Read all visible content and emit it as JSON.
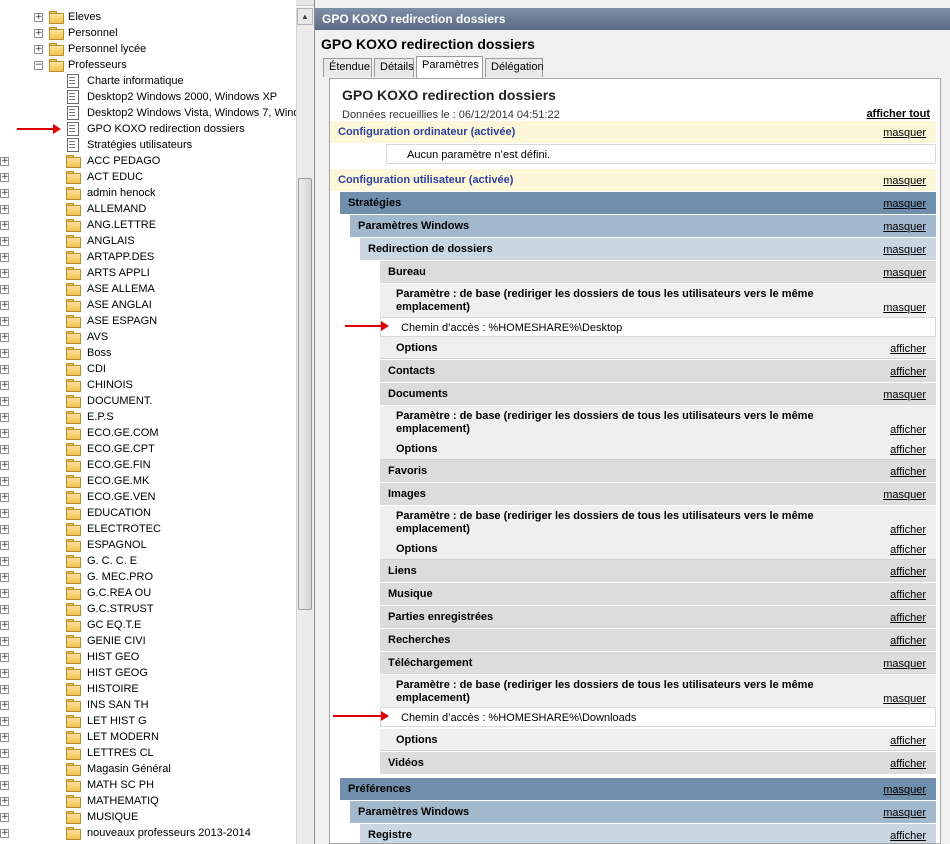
{
  "tree": {
    "items": [
      {
        "label": "Eleves",
        "icon": "folder-icon",
        "expander": "+"
      },
      {
        "label": "Personnel",
        "icon": "folder-icon",
        "expander": "+"
      },
      {
        "label": "Personnel lycée",
        "icon": "folder-icon",
        "expander": "+"
      },
      {
        "label": "Professeurs",
        "icon": "folder-icon",
        "expander": "−"
      },
      {
        "label": "Charte informatique",
        "icon": "gpo-link-icon",
        "expander": ""
      },
      {
        "label": "Desktop2 Windows 2000, Windows XP",
        "icon": "gpo-link-icon",
        "expander": ""
      },
      {
        "label": "Desktop2 Windows Vista, Windows 7, Wind",
        "icon": "gpo-link-icon",
        "expander": ""
      },
      {
        "label": "GPO KOXO redirection dossiers",
        "icon": "gpo-link-icon",
        "expander": ""
      },
      {
        "label": "Stratégies utilisateurs",
        "icon": "gpo-link-icon",
        "expander": ""
      },
      {
        "label": "ACC PEDAGO",
        "icon": "folder-icon",
        "expander": "+"
      },
      {
        "label": "ACT EDUC",
        "icon": "folder-icon",
        "expander": "+"
      },
      {
        "label": "admin henock",
        "icon": "folder-icon",
        "expander": "+"
      },
      {
        "label": "ALLEMAND",
        "icon": "folder-icon",
        "expander": "+"
      },
      {
        "label": "ANG.LETTRE",
        "icon": "folder-icon",
        "expander": "+"
      },
      {
        "label": "ANGLAIS",
        "icon": "folder-icon",
        "expander": "+"
      },
      {
        "label": "ARTAPP.DES",
        "icon": "folder-icon",
        "expander": "+"
      },
      {
        "label": "ARTS APPLI",
        "icon": "folder-icon",
        "expander": "+"
      },
      {
        "label": "ASE ALLEMA",
        "icon": "folder-icon",
        "expander": "+"
      },
      {
        "label": "ASE ANGLAI",
        "icon": "folder-icon",
        "expander": "+"
      },
      {
        "label": "ASE ESPAGN",
        "icon": "folder-icon",
        "expander": "+"
      },
      {
        "label": "AVS",
        "icon": "folder-icon",
        "expander": "+"
      },
      {
        "label": "Boss",
        "icon": "folder-icon",
        "expander": "+"
      },
      {
        "label": "CDI",
        "icon": "folder-icon",
        "expander": "+"
      },
      {
        "label": "CHINOIS",
        "icon": "folder-icon",
        "expander": "+"
      },
      {
        "label": "DOCUMENT.",
        "icon": "folder-icon",
        "expander": "+"
      },
      {
        "label": "E.P.S",
        "icon": "folder-icon",
        "expander": "+"
      },
      {
        "label": "ECO.GE.COM",
        "icon": "folder-icon",
        "expander": "+"
      },
      {
        "label": "ECO.GE.CPT",
        "icon": "folder-icon",
        "expander": "+"
      },
      {
        "label": "ECO.GE.FIN",
        "icon": "folder-icon",
        "expander": "+"
      },
      {
        "label": "ECO.GE.MK",
        "icon": "folder-icon",
        "expander": "+"
      },
      {
        "label": "ECO.GE.VEN",
        "icon": "folder-icon",
        "expander": "+"
      },
      {
        "label": "EDUCATION",
        "icon": "folder-icon",
        "expander": "+"
      },
      {
        "label": "ELECTROTEC",
        "icon": "folder-icon",
        "expander": "+"
      },
      {
        "label": "ESPAGNOL",
        "icon": "folder-icon",
        "expander": "+"
      },
      {
        "label": "G. C. C. E",
        "icon": "folder-icon",
        "expander": "+"
      },
      {
        "label": "G. MEC.PRO",
        "icon": "folder-icon",
        "expander": "+"
      },
      {
        "label": "G.C.REA OU",
        "icon": "folder-icon",
        "expander": "+"
      },
      {
        "label": "G.C.STRUST",
        "icon": "folder-icon",
        "expander": "+"
      },
      {
        "label": "GC EQ.T.E",
        "icon": "folder-icon",
        "expander": "+"
      },
      {
        "label": "GENIE CIVI",
        "icon": "folder-icon",
        "expander": "+"
      },
      {
        "label": "HIST GEO",
        "icon": "folder-icon",
        "expander": "+"
      },
      {
        "label": "HIST GEOG",
        "icon": "folder-icon",
        "expander": "+"
      },
      {
        "label": "HISTOIRE",
        "icon": "folder-icon",
        "expander": "+"
      },
      {
        "label": "INS SAN TH",
        "icon": "folder-icon",
        "expander": "+"
      },
      {
        "label": "LET HIST G",
        "icon": "folder-icon",
        "expander": "+"
      },
      {
        "label": "LET MODERN",
        "icon": "folder-icon",
        "expander": "+"
      },
      {
        "label": "LETTRES CL",
        "icon": "folder-icon",
        "expander": "+"
      },
      {
        "label": "Magasin Général",
        "icon": "folder-icon",
        "expander": "+"
      },
      {
        "label": "MATH SC PH",
        "icon": "folder-icon",
        "expander": "+"
      },
      {
        "label": "MATHEMATIQ",
        "icon": "folder-icon",
        "expander": "+"
      },
      {
        "label": "MUSIQUE",
        "icon": "folder-icon",
        "expander": "+"
      },
      {
        "label": "nouveaux professeurs 2013-2014",
        "icon": "folder-icon",
        "expander": "+"
      }
    ]
  },
  "window": {
    "title": "GPO KOXO redirection dossiers"
  },
  "pane": {
    "heading": "GPO KOXO redirection dossiers",
    "tabs": [
      "Étendue",
      "Détails",
      "Paramètres",
      "Délégation"
    ],
    "active_tab": "Paramètres"
  },
  "report": {
    "title": "GPO KOXO redirection dossiers",
    "date": "Données recueillies le : 06/12/2014 04:51:22",
    "show_all": "afficher tout",
    "rows": [
      {
        "type": "cfg",
        "title": "Configuration ordinateur (activée)",
        "link": "masquer"
      },
      {
        "type": "text",
        "indent": 1,
        "text": "Aucun paramètre n’est défini."
      },
      {
        "type": "cfg",
        "title": "Configuration utilisateur (activée)",
        "link": "masquer"
      },
      {
        "type": "l1",
        "title": "Stratégies",
        "link": "masquer"
      },
      {
        "type": "l2",
        "title": "Paramètres Windows",
        "link": "masquer"
      },
      {
        "type": "l3",
        "title": "Redirection de dossiers",
        "link": "masquer"
      },
      {
        "type": "l4",
        "title": "Bureau",
        "link": "masquer"
      },
      {
        "type": "l4t",
        "title": "Paramètre : de base (rediriger les dossiers de tous les utilisateurs vers le même emplacement)",
        "link": "masquer"
      },
      {
        "type": "text",
        "indent": 2,
        "text": "Chemin d’accès : %HOMESHARE%\\Desktop",
        "arrow": true
      },
      {
        "type": "l4",
        "title": "Options",
        "link": "afficher",
        "sub": true
      },
      {
        "type": "l4",
        "title": "Contacts",
        "link": "afficher"
      },
      {
        "type": "l4",
        "title": "Documents",
        "link": "masquer"
      },
      {
        "type": "l4t",
        "title": "Paramètre : de base (rediriger les dossiers de tous les utilisateurs vers le même emplacement)",
        "link": "afficher"
      },
      {
        "type": "l4",
        "title": "Options",
        "link": "afficher",
        "sub": true
      },
      {
        "type": "l4",
        "title": "Favoris",
        "link": "afficher"
      },
      {
        "type": "l4",
        "title": "Images",
        "link": "masquer"
      },
      {
        "type": "l4t",
        "title": "Paramètre : de base (rediriger les dossiers de tous les utilisateurs vers le même emplacement)",
        "link": "afficher"
      },
      {
        "type": "l4",
        "title": "Options",
        "link": "afficher",
        "sub": true
      },
      {
        "type": "l4",
        "title": "Liens",
        "link": "afficher"
      },
      {
        "type": "l4",
        "title": "Musique",
        "link": "afficher"
      },
      {
        "type": "l4",
        "title": "Parties enregistrées",
        "link": "afficher"
      },
      {
        "type": "l4",
        "title": "Recherches",
        "link": "afficher"
      },
      {
        "type": "l4",
        "title": "Téléchargement",
        "link": "masquer"
      },
      {
        "type": "l4t",
        "title": "Paramètre : de base (rediriger les dossiers de tous les utilisateurs vers le même emplacement)",
        "link": "masquer"
      },
      {
        "type": "text",
        "indent": 2,
        "text": "Chemin d’accès : %HOMESHARE%\\Downloads",
        "arrow": true
      },
      {
        "type": "l4",
        "title": "Options",
        "link": "afficher",
        "sub": true
      },
      {
        "type": "l4",
        "title": "Vidéos",
        "link": "afficher"
      },
      {
        "type": "l1",
        "title": "Préférences",
        "link": "masquer"
      },
      {
        "type": "l2",
        "title": "Paramètres Windows",
        "link": "masquer"
      },
      {
        "type": "l3",
        "title": "Registre",
        "link": "afficher"
      }
    ]
  }
}
